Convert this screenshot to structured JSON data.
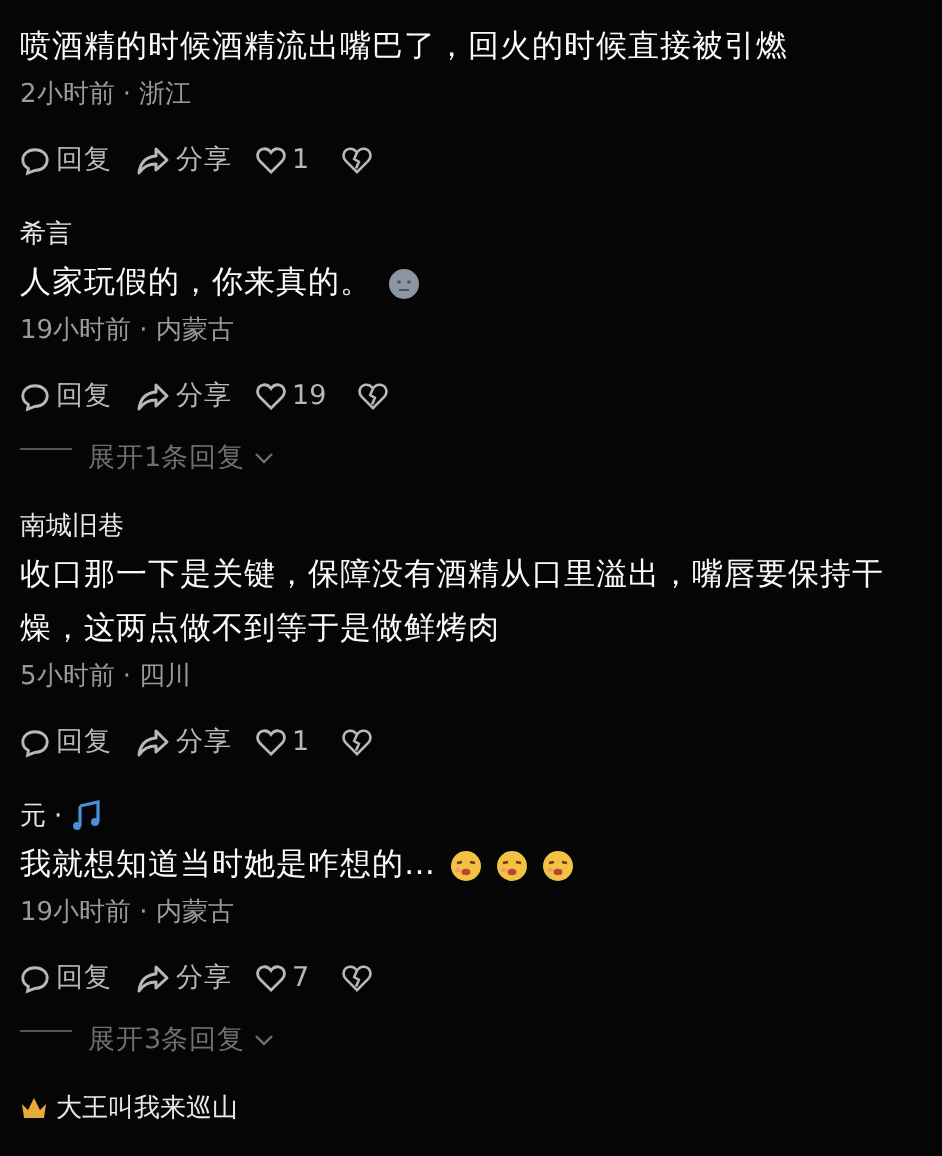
{
  "comments": [
    {
      "text": "喷酒精的时候酒精流出嘴巴了，回火的时候直接被引燃",
      "meta": "2小时前 · 浙江",
      "reply_label": "回复",
      "share_label": "分享",
      "likes": "1"
    },
    {
      "name": "希言",
      "text": "人家玩假的，你来真的。",
      "emojis": [
        {
          "kind": "neutral"
        }
      ],
      "meta": "19小时前 · 内蒙古",
      "reply_label": "回复",
      "share_label": "分享",
      "likes": "19",
      "expand": "展开1条回复"
    },
    {
      "name": "南城旧巷",
      "text": "收口那一下是关键，保障没有酒精从口里溢出，嘴唇要保持干燥，这两点做不到等于是做鲜烤肉",
      "meta": "5小时前 · 四川",
      "reply_label": "回复",
      "share_label": "分享",
      "likes": "1"
    },
    {
      "name": "元",
      "name_suffix": "·",
      "badge": {
        "kind": "music"
      },
      "text": "我就想知道当时她是咋想的…",
      "emojis": [
        {
          "kind": "drool"
        },
        {
          "kind": "drool"
        },
        {
          "kind": "drool"
        }
      ],
      "meta": "19小时前 · 内蒙古",
      "reply_label": "回复",
      "share_label": "分享",
      "likes": "7",
      "expand": "展开3条回复"
    },
    {
      "name": "大王叫我来巡山",
      "prefix_badge": {
        "kind": "crown"
      }
    }
  ]
}
